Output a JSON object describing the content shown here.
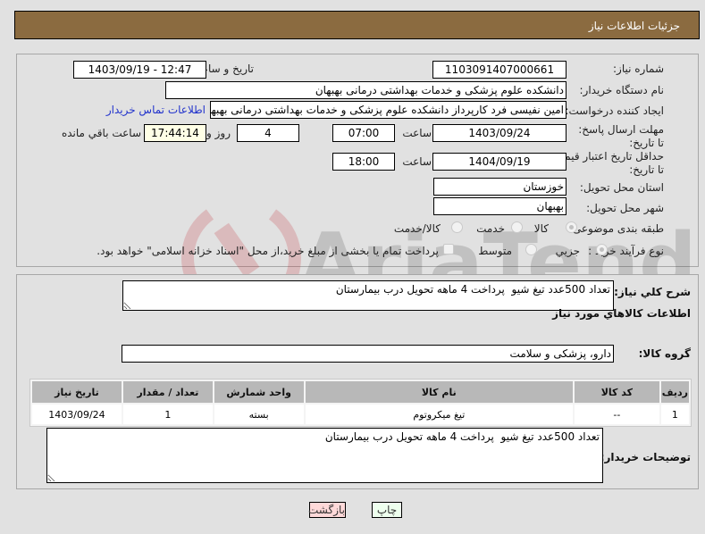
{
  "header": {
    "title": "جزئیات اطلاعات نیاز"
  },
  "form": {
    "need_number": {
      "label": "شماره نیاز:",
      "value": "1103091407000661"
    },
    "announce_datetime": {
      "label": "تاریخ و ساعت اعلان عمومي:",
      "value": "1403/09/19 - 12:47"
    },
    "buyer_org": {
      "label": "نام دستگاه خريدار:",
      "value": "دانشکده علوم پزشکی و خدمات بهداشتی  درمانی بهبهان"
    },
    "requester": {
      "label": "ایجاد کننده درخواست:",
      "value": "امین نفیسی فرد کارپرداز دانشکده علوم پزشکی و خدمات بهداشتی  درمانی بهبهان"
    },
    "buyer_contact_link": "اطلاعات تماس خريدار",
    "reply_deadline": {
      "label": "مهلت ارسال پاسخ: تا تاریخ:",
      "date": "1403/09/24",
      "time_label": "ساعت",
      "time": "07:00",
      "days": "4",
      "days_label": "روز و",
      "remaining": "17:44:14",
      "remaining_label": "ساعت باقي مانده"
    },
    "price_validity": {
      "label": "حداقل تاریخ اعتبار قیمت: تا تاریخ:",
      "date": "1404/09/19",
      "time_label": "ساعت",
      "time": "18:00"
    },
    "delivery_province": {
      "label": "استان محل تحویل:",
      "value": "خوزستان"
    },
    "delivery_city": {
      "label": "شهر محل تحویل:",
      "value": "بهبهان"
    },
    "category": {
      "label": "طبقه بندی موضوعی:",
      "options": [
        "کالا",
        "خدمت",
        "کالا/خدمت"
      ],
      "selected": "کالا"
    },
    "purchase_type": {
      "label": "نوع فرآیند خرید :",
      "options": [
        "جزیي",
        "متوسط"
      ],
      "selected": "جزیي",
      "treasury_checkbox_label": "پرداخت تمام یا بخشی از مبلغ خرید،از محل \"اسناد خزانه اسلامی\" خواهد بود.",
      "treasury_checked": false
    }
  },
  "details": {
    "description_label": "شرح کلي نياز:",
    "description": "تعداد 500عدد تیغ شیو  پرداخت 4 ماهه تحویل درب بیمارستان",
    "goods_section_title": "اطلاعات کالاهاي مورد نياز",
    "goods_group_label": "گروه کالا:",
    "goods_group": "دارو، پزشکی و سلامت",
    "table": {
      "headers": [
        "رديف",
        "کد کالا",
        "نام کالا",
        "واحد شمارش",
        "تعداد / مقدار",
        "تاریخ نیاز"
      ],
      "rows": [
        [
          "1",
          "--",
          "تیغ میکروتوم",
          "بسته",
          "1",
          "1403/09/24"
        ]
      ]
    },
    "buyer_notes_label": "توضیحات خریدار:",
    "buyer_notes": "تعداد 500عدد تیغ شیو  پرداخت 4 ماهه تحویل درب بیمارستان"
  },
  "buttons": {
    "back": "بازگشت",
    "print": "چاپ"
  },
  "colors": {
    "header": "#8b6b40",
    "link": "#2233cc",
    "back_bg": "#ffd9d9",
    "print_bg": "#eeffee",
    "countdown_bg": "#ffffe6"
  }
}
